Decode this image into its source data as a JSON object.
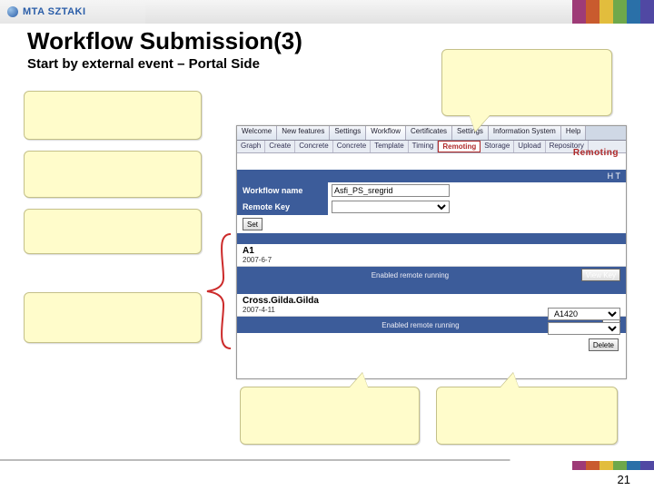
{
  "brand": "MTA SZTAKI",
  "title": "Workflow Submission(3)",
  "subtitle": "Start by external event – Portal Side",
  "page_number": "21",
  "portal": {
    "tabs": [
      "Welcome",
      "New features",
      "Settings",
      "Workflow",
      "Certificates",
      "Settings",
      "Information System",
      "Help"
    ],
    "active_tab_index": 3,
    "subtabs": [
      "Graph",
      "Create",
      "Concrete",
      "Concrete",
      "Template",
      "Timing",
      "Remoting",
      "Storage",
      "Upload",
      "Repository"
    ],
    "active_subtab_index": 6,
    "section_heading": "Remoting",
    "top_right_corner": "H T",
    "workflow_name_label": "Workflow name",
    "workflow_name_value": "Asfi_PS_sregrid",
    "remote_key_label": "Remote Key",
    "set_button": "Set",
    "entries": [
      {
        "name": "A1",
        "date": "2007-6-7",
        "status": "Enabled remote running",
        "button": "View Key"
      },
      {
        "name": "Cross.Gilda.Gilda",
        "date": "2007-4-11",
        "status": "Enabled remote running",
        "button": "ice"
      }
    ],
    "delete_button": "Delete",
    "dropdown_placeholder": "A1420"
  }
}
